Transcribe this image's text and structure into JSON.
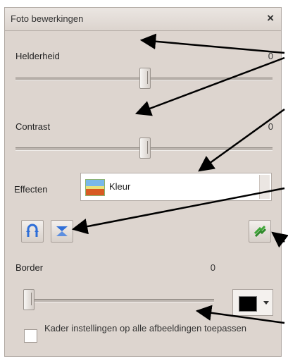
{
  "panel": {
    "title": "Foto bewerkingen",
    "close_glyph": "×"
  },
  "brightness": {
    "label": "Helderheid",
    "value": "0",
    "level": 0.5
  },
  "contrast": {
    "label": "Contrast",
    "value": "0",
    "level": 0.5
  },
  "effects": {
    "label": "Effecten",
    "selected": "Kleur",
    "icon": "color-effect-icon"
  },
  "tools": {
    "rotate_icon": "rotate-flip-icon",
    "mirror_icon": "mirror-icon",
    "reset_icon": "reset-arrows-icon"
  },
  "border": {
    "label": "Border",
    "value": "0",
    "level": 0.0,
    "color": "#000000"
  },
  "apply_all": {
    "label": "Kader instellingen op alle afbeeldingen toepassen",
    "checked": false
  },
  "colors": {
    "panel_bg": "#ddd5cf",
    "accent_blue": "#2f6fd8",
    "accent_green": "#3da637",
    "arrow": "#000000"
  }
}
